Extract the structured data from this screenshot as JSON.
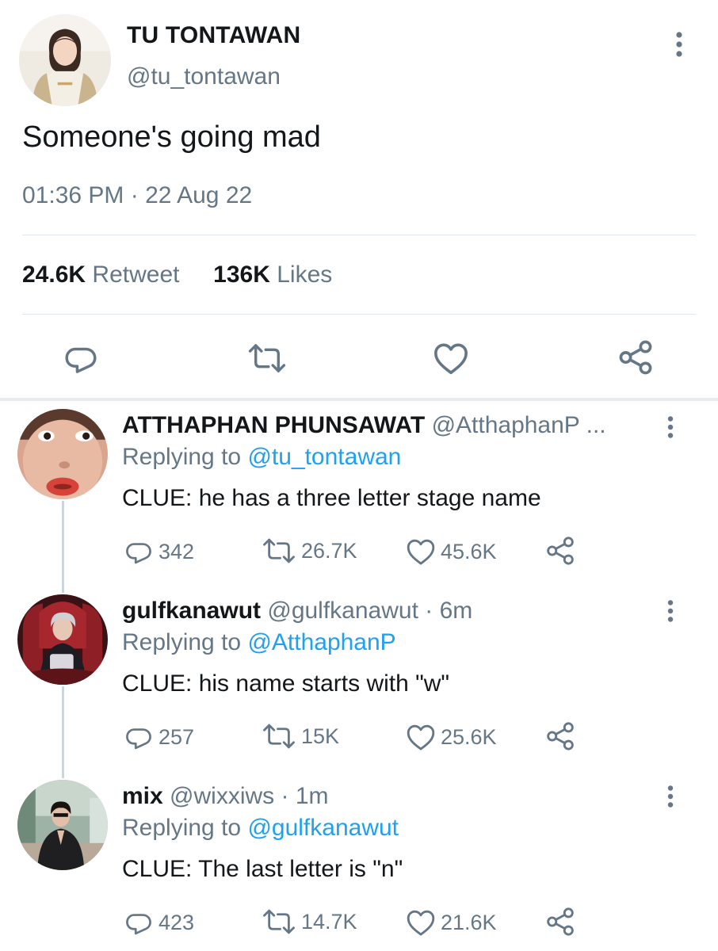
{
  "tweet": {
    "author_name": "TU TONTAWAN",
    "author_handle": "@tu_tontawan",
    "text": "Someone's going mad",
    "timestamp": "01:36 PM · 22 Aug 22",
    "retweet_count": "24.6K",
    "retweet_label": "Retweet",
    "likes_count": "136K",
    "likes_label": "Likes"
  },
  "actions": [
    "reply-icon",
    "retweet-icon",
    "like-icon",
    "share-icon"
  ],
  "replies": [
    {
      "name": "ATTHAPHAN PHUNSAWAT",
      "handle": "@AtthaphanP ...",
      "replying_prefix": "Replying to",
      "replying_to": "@tu_tontawan",
      "text": "CLUE: he has a three letter stage name",
      "reply_count": "342",
      "retweet_count": "26.7K",
      "like_count": "45.6K"
    },
    {
      "name": "gulfkanawut",
      "handle": "@gulfkanawut · 6m",
      "replying_prefix": "Replying to",
      "replying_to": "@AtthaphanP",
      "text": "CLUE: his name starts with \"w\"",
      "reply_count": "257",
      "retweet_count": "15K",
      "like_count": "25.6K"
    },
    {
      "name": "mix",
      "handle": "@wixxiws · 1m",
      "replying_prefix": "Replying to",
      "replying_to": "@gulfkanawut",
      "text": "CLUE: The last letter is \"n\"",
      "reply_count": "423",
      "retweet_count": "14.7K",
      "like_count": "21.6K"
    }
  ],
  "colors": {
    "text": "#14171a",
    "secondary": "#657786",
    "link": "#1da1f2",
    "divider": "#e1e8ed"
  }
}
